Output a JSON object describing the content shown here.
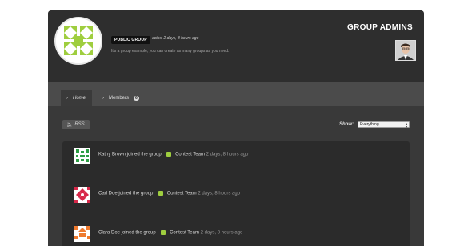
{
  "group": {
    "badge": "PUBLIC GROUP",
    "active": "active 2 days, 8 hours ago",
    "description": "It's a group example, you can create as many groups as you need.",
    "admins_title": "GROUP ADMINS"
  },
  "nav": {
    "tabs": [
      {
        "label": "Home",
        "active": true
      },
      {
        "label": "Members",
        "count": "6"
      }
    ]
  },
  "toolbar": {
    "rss_label": "RSS",
    "show_label": "Show:",
    "show_value": "Everything"
  },
  "activity": [
    {
      "text": "Kathy Brown joined the group",
      "team": "Contest Team",
      "ago": "2 days, 8 hours ago",
      "avatar": "green"
    },
    {
      "text": "Carl Doe joined the group",
      "team": "Contest Team",
      "ago": "2 days, 8 hours ago",
      "avatar": "red"
    },
    {
      "text": "Clara Doe joined the group",
      "team": "Contest Team",
      "ago": "2 days, 8 hours ago",
      "avatar": "orange"
    }
  ],
  "colors": {
    "accent": "#9fce3f",
    "dark_bg": "#2d2d2d"
  }
}
